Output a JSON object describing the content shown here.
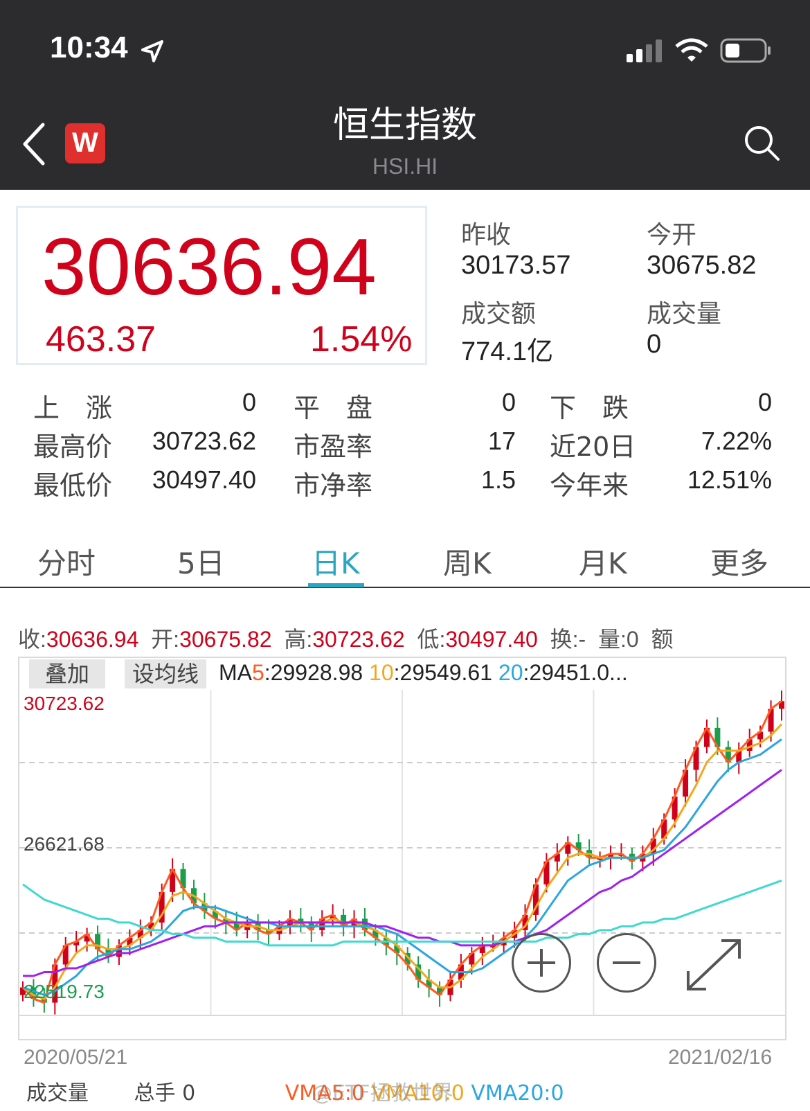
{
  "status_bar": {
    "time": "10:34"
  },
  "nav": {
    "title": "恒生指数",
    "code": "HSI.HI",
    "logo_letter": "W"
  },
  "quote": {
    "price": "30636.94",
    "change": "463.37",
    "change_pct": "1.54%",
    "prev_close_label": "昨收",
    "prev_close": "30173.57",
    "open_label": "今开",
    "open": "30675.82",
    "turnover_label": "成交额",
    "turnover": "774.1亿",
    "volume_label": "成交量",
    "volume": "0"
  },
  "stats": [
    {
      "label": "上　涨",
      "value": "0",
      "label2": "平　盘",
      "value2": "0",
      "label3": "下　跌",
      "value3": "0"
    },
    {
      "label": "最高价",
      "value": "30723.62",
      "label2": "市盈率",
      "value2": "17",
      "label3": "近20日",
      "value3": "7.22%"
    },
    {
      "label": "最低价",
      "value": "30497.40",
      "label2": "市净率",
      "value2": "1.5",
      "label3": "今年来",
      "value3": "12.51%"
    }
  ],
  "tabs": [
    "分时",
    "5日",
    "日K",
    "周K",
    "月K",
    "更多"
  ],
  "active_tab": "日K",
  "ohlc": {
    "close_label": "收:",
    "close": "30636.94",
    "open_label": "开:",
    "open": "30675.82",
    "high_label": "高:",
    "high": "30723.62",
    "low_label": "低:",
    "low": "30497.40",
    "turnover_label": "换:",
    "turnover": "-",
    "vol_label": "量:",
    "vol": "0",
    "extra": "额"
  },
  "chart_toolbar": {
    "overlay": "叠加",
    "set_ma": "设均线"
  },
  "ma_values": {
    "ma5_prefix": "MA",
    "ma5_num": "5",
    "ma5": ":29928.98",
    "ma10_num": "10",
    "ma10": ":29549.61",
    "ma20_num": "20",
    "ma20": ":29451.0..."
  },
  "volume_row": {
    "label": "成交量",
    "total": "总手 0",
    "vma5": "VMA5:0",
    "vma10": "VMA10:0",
    "vma20": "VMA20:0",
    "watermark": "@ETF拯救世界"
  },
  "colors": {
    "up": "#d0021b",
    "down": "#1a9e4b",
    "ma5": "#ff5a1f",
    "ma10": "#f2a81d",
    "ma20": "#2aa6e0",
    "ma60": "#a020f0",
    "ma120": "#3fd9d0",
    "accent": "#2aa6c0"
  },
  "chart_data": {
    "type": "line",
    "title": "",
    "ylabels": [
      "30723.62",
      "26621.68",
      "22519.73"
    ],
    "ylim": [
      22519.73,
      30723.62
    ],
    "x_start": "2020/05/21",
    "x_end": "2021/02/16",
    "series": [
      {
        "values": [
          23000,
          22700,
          22600,
          23600,
          24100,
          24200,
          24400,
          24000,
          23800,
          24100,
          24300,
          24500,
          24700,
          25500,
          26100,
          25600,
          25200,
          25000,
          24800,
          24700,
          24500,
          24700,
          24500,
          24400,
          24600,
          24800,
          24700,
          24500,
          24800,
          24900,
          24600,
          24800,
          24500,
          24300,
          24100,
          23900,
          23600,
          23200,
          23000,
          22800,
          23200,
          23600,
          23900,
          24100,
          24100,
          24300,
          24500,
          24900,
          25700,
          26300,
          26500,
          26800,
          26600,
          26400,
          26400,
          26500,
          26500,
          26300,
          26500,
          26900,
          27400,
          28000,
          28700,
          29300,
          29800,
          29300,
          28900,
          29200,
          29500,
          29700,
          30300,
          30500
        ]
      },
      {
        "values": [
          23000,
          22800,
          22700,
          23000,
          23500,
          23900,
          24100,
          24100,
          24000,
          24000,
          24100,
          24300,
          24500,
          24900,
          25400,
          25500,
          25400,
          25200,
          25000,
          24800,
          24700,
          24600,
          24600,
          24500,
          24500,
          24600,
          24700,
          24700,
          24700,
          24800,
          24700,
          24700,
          24600,
          24500,
          24300,
          24100,
          23800,
          23500,
          23200,
          23000,
          23000,
          23200,
          23500,
          23800,
          24000,
          24200,
          24400,
          24600,
          25100,
          25600,
          26000,
          26400,
          26500,
          26500,
          26400,
          26400,
          26400,
          26400,
          26400,
          26600,
          26900,
          27300,
          27800,
          28300,
          28900,
          29200,
          29200,
          29200,
          29300,
          29400,
          29600,
          29900
        ]
      },
      {
        "values": [
          23000,
          22900,
          22800,
          22900,
          23100,
          23300,
          23600,
          23800,
          23900,
          24000,
          24000,
          24100,
          24200,
          24400,
          24700,
          25000,
          25100,
          25100,
          25100,
          25000,
          24900,
          24800,
          24700,
          24700,
          24600,
          24600,
          24600,
          24600,
          24600,
          24600,
          24600,
          24600,
          24600,
          24600,
          24500,
          24400,
          24200,
          24000,
          23800,
          23600,
          23400,
          23400,
          23400,
          23500,
          23700,
          23900,
          24100,
          24300,
          24600,
          25000,
          25400,
          25800,
          26000,
          26200,
          26300,
          26400,
          26400,
          26400,
          26400,
          26500,
          26600,
          26900,
          27200,
          27600,
          28000,
          28400,
          28700,
          28900,
          29000,
          29100,
          29300,
          29500
        ]
      },
      {
        "values": [
          23300,
          23300,
          23400,
          23400,
          23500,
          23500,
          23600,
          23700,
          23800,
          23900,
          23900,
          24000,
          24100,
          24200,
          24300,
          24400,
          24500,
          24600,
          24600,
          24700,
          24700,
          24700,
          24700,
          24700,
          24700,
          24700,
          24700,
          24700,
          24700,
          24700,
          24700,
          24700,
          24700,
          24600,
          24600,
          24500,
          24400,
          24300,
          24300,
          24200,
          24200,
          24100,
          24100,
          24100,
          24100,
          24200,
          24200,
          24300,
          24400,
          24500,
          24700,
          24900,
          25100,
          25300,
          25500,
          25600,
          25800,
          25900,
          26100,
          26300,
          26500,
          26700,
          26900,
          27100,
          27300,
          27500,
          27700,
          27900,
          28100,
          28300,
          28500,
          28700
        ]
      },
      {
        "values": [
          25700,
          25500,
          25300,
          25200,
          25100,
          25000,
          24900,
          24800,
          24800,
          24700,
          24700,
          24600,
          24500,
          24500,
          24400,
          24400,
          24300,
          24300,
          24300,
          24200,
          24200,
          24200,
          24200,
          24100,
          24100,
          24100,
          24100,
          24100,
          24100,
          24100,
          24200,
          24200,
          24200,
          24200,
          24200,
          24200,
          24200,
          24200,
          24200,
          24200,
          24200,
          24200,
          24200,
          24200,
          24200,
          24200,
          24200,
          24200,
          24200,
          24300,
          24300,
          24300,
          24400,
          24400,
          24500,
          24500,
          24600,
          24600,
          24700,
          24700,
          24800,
          24800,
          24900,
          25000,
          25100,
          25200,
          25300,
          25400,
          25500,
          25600,
          25700,
          25800
        ]
      }
    ]
  }
}
